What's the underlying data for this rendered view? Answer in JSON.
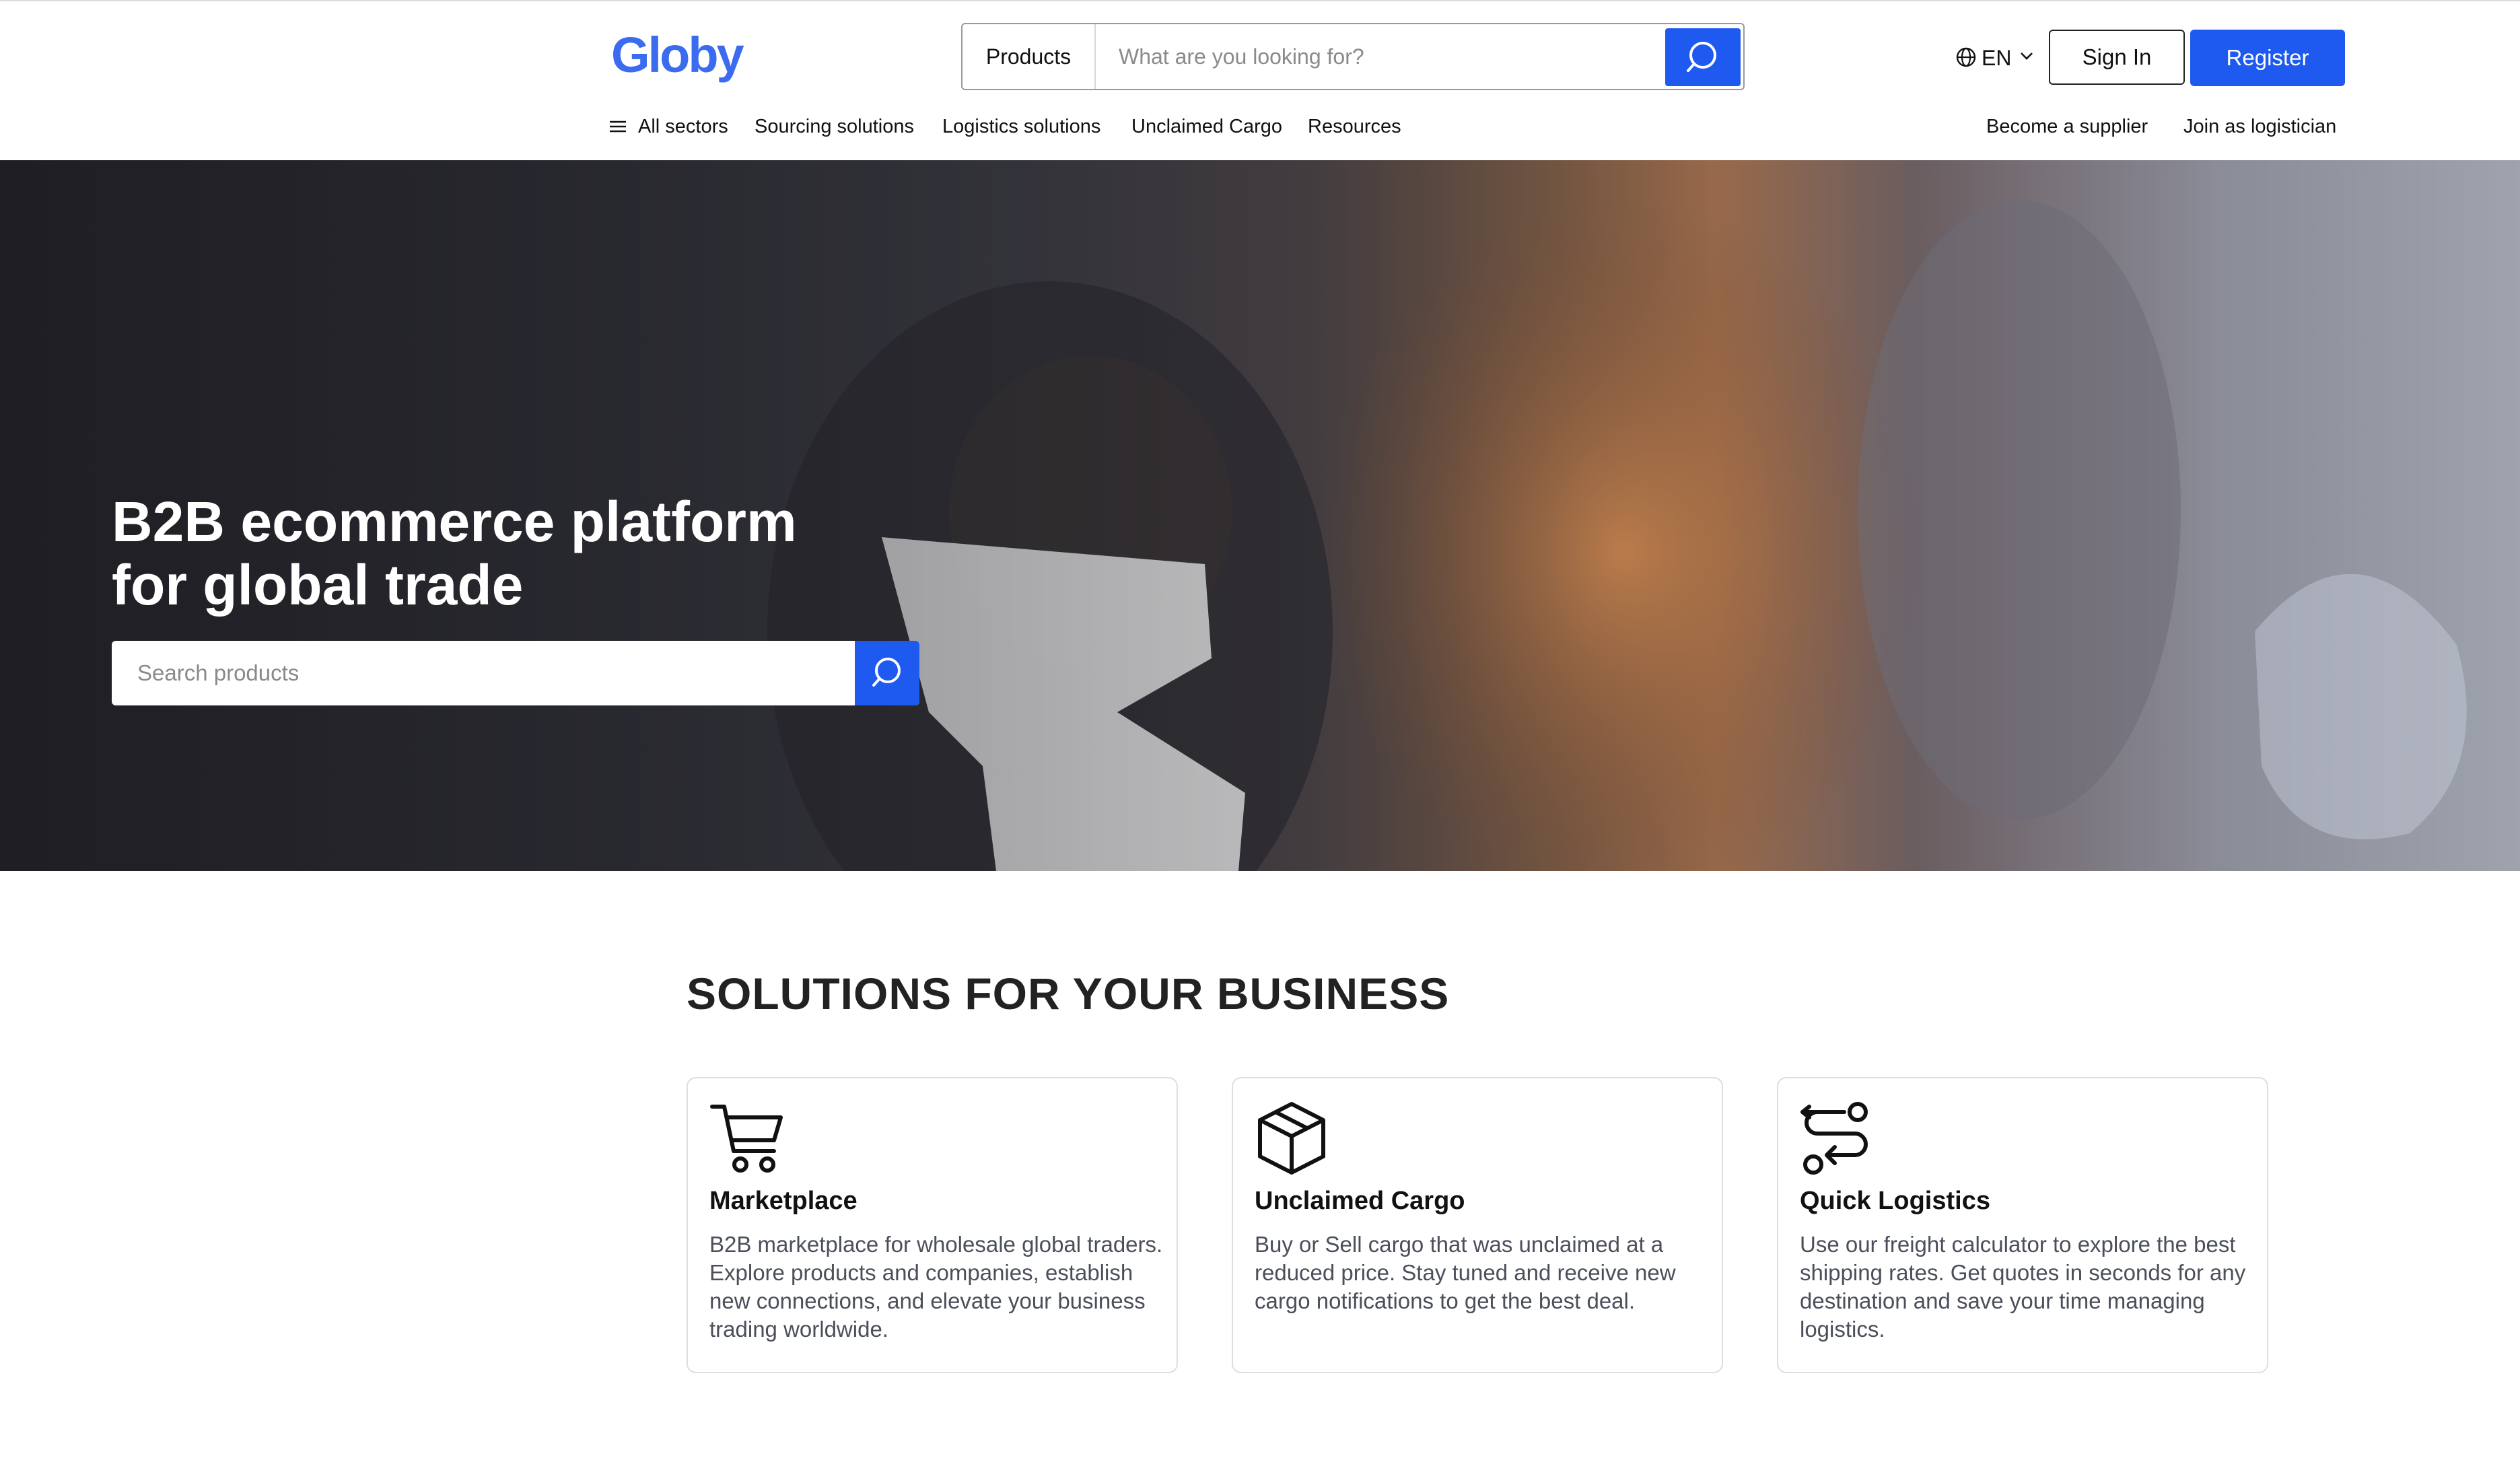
{
  "header": {
    "logo": "Globy",
    "search_category": "Products",
    "search_placeholder": "What are you looking for?",
    "language": "EN",
    "sign_in": "Sign In",
    "register": "Register"
  },
  "nav": {
    "items": [
      "All sectors",
      "Sourcing solutions",
      "Logistics solutions",
      "Unclaimed Cargo",
      "Resources"
    ],
    "right_items": [
      "Become a supplier",
      "Join as logistician"
    ]
  },
  "hero": {
    "title_line1": "B2B ecommerce platform",
    "title_line2": "for global trade",
    "search_placeholder": "Search products"
  },
  "solutions": {
    "title": "SOLUTIONS FOR YOUR BUSINESS",
    "cards": [
      {
        "icon": "cart-icon",
        "title": "Marketplace",
        "description": "B2B marketplace for wholesale global traders. Explore products and companies, establish new connections, and elevate your business trading worldwide."
      },
      {
        "icon": "box-icon",
        "title": "Unclaimed Cargo",
        "description": "Buy or Sell cargo that was unclaimed at a reduced price. Stay tuned and receive new cargo notifications to get the best deal."
      },
      {
        "icon": "route-icon",
        "title": "Quick Logistics",
        "description": "Use our freight calculator to explore the best shipping rates. Get quotes in seconds for any destination and save your time managing logistics."
      }
    ]
  },
  "colors": {
    "brand": "#3b6cf0",
    "primary_button": "#1e5af0"
  }
}
